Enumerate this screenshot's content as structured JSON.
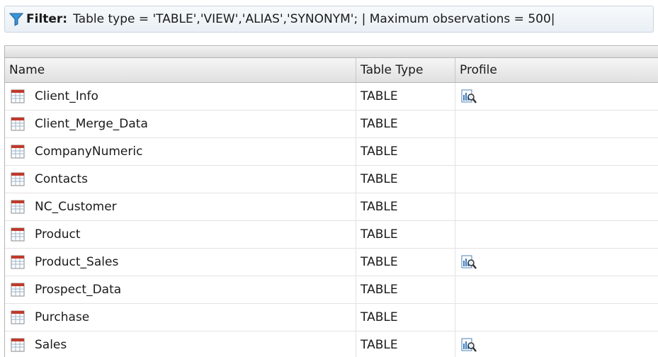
{
  "filter": {
    "label": "Filter:",
    "text": "Table type = 'TABLE','VIEW','ALIAS','SYNONYM'; | Maximum observations = 500|"
  },
  "table": {
    "headers": {
      "name": "Name",
      "type": "Table Type",
      "profile": "Profile"
    },
    "rows": [
      {
        "name": "Client_Info",
        "type": "TABLE",
        "profile": true
      },
      {
        "name": "Client_Merge_Data",
        "type": "TABLE",
        "profile": false
      },
      {
        "name": "CompanyNumeric",
        "type": "TABLE",
        "profile": false
      },
      {
        "name": "Contacts",
        "type": "TABLE",
        "profile": false
      },
      {
        "name": "NC_Customer",
        "type": "TABLE",
        "profile": false
      },
      {
        "name": "Product",
        "type": "TABLE",
        "profile": false
      },
      {
        "name": "Product_Sales",
        "type": "TABLE",
        "profile": true
      },
      {
        "name": "Prospect_Data",
        "type": "TABLE",
        "profile": false
      },
      {
        "name": "Purchase",
        "type": "TABLE",
        "profile": false
      },
      {
        "name": "Sales",
        "type": "TABLE",
        "profile": true
      }
    ]
  },
  "icons": {
    "filter": "funnel-icon",
    "table": "table-icon",
    "profile": "profile-report-icon"
  },
  "colors": {
    "accent": "#2e86c8",
    "header_bg": "#e6e6e6",
    "table_icon_red": "#c0392b"
  }
}
